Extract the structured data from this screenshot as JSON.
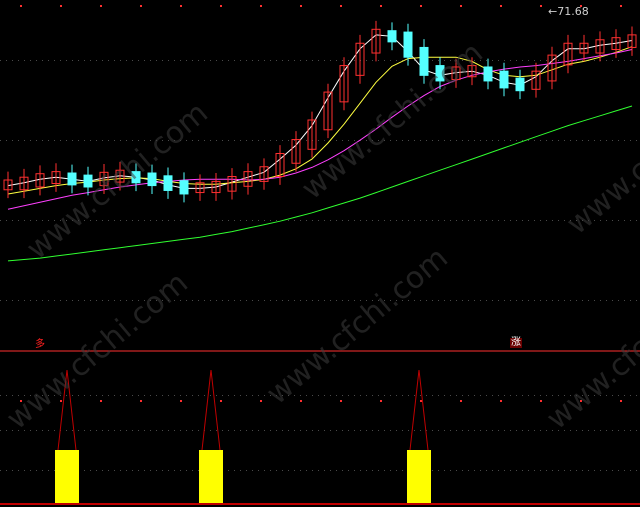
{
  "chart_data": [
    {
      "type": "candlestick",
      "title": "",
      "high_label": "71.68",
      "colors": {
        "up": "#ff3030",
        "down": "#54ffff",
        "ma5": "#ffffff",
        "ma10": "#ffff40",
        "ma20": "#ff40ff",
        "ma60": "#30ff30",
        "grid_dots": "#ff3030",
        "background": "#000000"
      },
      "series": [
        {
          "name": "MA5",
          "values": [
            46.4,
            46.8,
            47.3,
            47.6,
            47.3,
            47.0,
            47.5,
            47.8,
            47.6,
            47.2,
            46.5,
            46.0,
            46.0,
            46.2,
            46.9,
            47.6,
            48.3,
            50.2,
            52.2,
            55.0,
            59.0,
            62.8,
            66.0,
            68.0,
            67.8,
            65.6,
            63.0,
            62.2,
            62.6,
            62.8,
            62.2,
            61.2,
            60.8,
            62.0,
            64.3,
            66.0,
            66.0,
            66.5,
            66.8,
            67.2
          ]
        },
        {
          "name": "MA10",
          "values": [
            45.2,
            45.6,
            46.0,
            46.4,
            46.7,
            46.9,
            47.2,
            47.4,
            47.5,
            47.4,
            47.0,
            46.7,
            46.6,
            46.6,
            46.8,
            47.0,
            47.3,
            47.9,
            48.8,
            50.2,
            52.5,
            55.2,
            58.2,
            61.2,
            63.5,
            64.6,
            64.8,
            64.8,
            64.8,
            64.2,
            63.0,
            62.2,
            62.0,
            62.2,
            63.0,
            63.8,
            64.2,
            64.8,
            65.5,
            66.3
          ]
        },
        {
          "name": "MA20",
          "values": [
            43.0,
            43.5,
            44.0,
            44.5,
            45.0,
            45.4,
            45.8,
            46.2,
            46.5,
            46.8,
            47.0,
            47.2,
            47.3,
            47.3,
            47.3,
            47.2,
            47.3,
            47.6,
            48.2,
            49.0,
            50.1,
            51.4,
            52.9,
            54.5,
            56.2,
            57.8,
            59.3,
            60.6,
            61.5,
            62.2,
            62.7,
            63.1,
            63.4,
            63.6,
            63.9,
            64.2,
            64.6,
            65.0,
            65.4,
            65.9
          ]
        },
        {
          "name": "MA60",
          "values": [
            35.6,
            35.8,
            36.0,
            36.3,
            36.6,
            36.9,
            37.2,
            37.5,
            37.8,
            38.1,
            38.4,
            38.7,
            39.0,
            39.4,
            39.8,
            40.3,
            40.8,
            41.3,
            41.9,
            42.5,
            43.2,
            43.9,
            44.6,
            45.4,
            46.2,
            47.0,
            47.8,
            48.6,
            49.4,
            50.2,
            51.0,
            51.8,
            52.6,
            53.4,
            54.2,
            55.0,
            55.7,
            56.4,
            57.1,
            57.8
          ]
        }
      ],
      "ylim": [
        30,
        73
      ]
    },
    {
      "type": "bar",
      "title": "",
      "markers": [
        {
          "text": "多",
          "index": 1,
          "boxed": false
        },
        {
          "text": "涨",
          "index": 26,
          "boxed": true
        }
      ],
      "signals": [
        {
          "index": 2,
          "value": 1
        },
        {
          "index": 11,
          "value": 1
        },
        {
          "index": 24,
          "value": 1
        }
      ],
      "colors": {
        "bar": "#ffff00",
        "spike": "#c00000",
        "baseline": "#ff0000",
        "grid_dots": "#ff3030"
      },
      "ylim": [
        0,
        1
      ]
    }
  ],
  "watermarks": [
    "www.cfchi.com",
    "www.cfchi.com",
    "www.cfchi.com",
    "www.cfchi.com",
    "www.cfchi.com",
    "www.cfchi.com"
  ]
}
